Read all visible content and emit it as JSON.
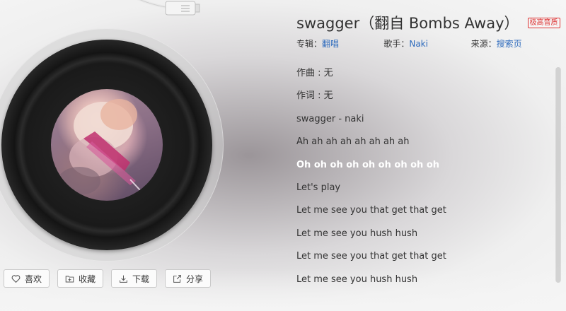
{
  "song": {
    "title": "swagger（翻自 Bombs Away）",
    "quality_badge": "极高音质",
    "meta": {
      "album_label": "专辑：",
      "album_value": "翻唱",
      "artist_label": "歌手：",
      "artist_value": "Naki",
      "source_label": "来源：",
      "source_value": "搜索页"
    }
  },
  "lyrics": [
    {
      "text": "作曲 : 无",
      "current": false
    },
    {
      "text": "作词 : 无",
      "current": false
    },
    {
      "text": "swagger - naki",
      "current": false
    },
    {
      "text": "Ah ah ah ah ah ah ah ah",
      "current": false
    },
    {
      "text": "Oh oh oh oh oh oh oh oh oh",
      "current": true
    },
    {
      "text": "Let's play",
      "current": false
    },
    {
      "text": "Let me see you that get that get",
      "current": false
    },
    {
      "text": "Let me see you hush hush",
      "current": false
    },
    {
      "text": "Let me see you that get that get",
      "current": false
    },
    {
      "text": "Let me see you hush hush",
      "current": false
    }
  ],
  "actions": {
    "like": {
      "label": "喜欢",
      "icon": "heart-icon"
    },
    "collect": {
      "label": "收藏",
      "icon": "folder-plus-icon"
    },
    "download": {
      "label": "下载",
      "icon": "download-icon"
    },
    "share": {
      "label": "分享",
      "icon": "share-icon"
    }
  },
  "colors": {
    "link": "#2e6bbd",
    "badge": "#dd3333",
    "current_lyric": "#ffffff"
  }
}
